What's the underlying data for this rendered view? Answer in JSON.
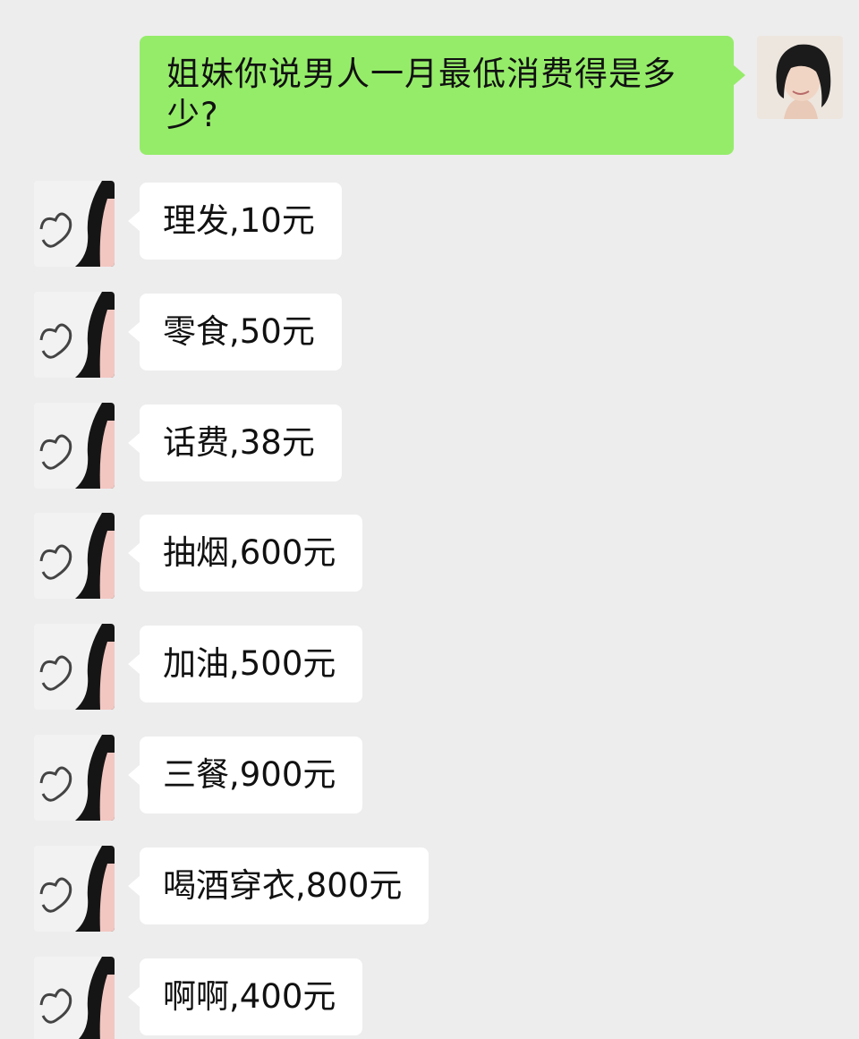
{
  "outgoing": {
    "text": "姐妹你说男人一月最低消费得是多少?"
  },
  "incoming": [
    {
      "text": "理发,10元"
    },
    {
      "text": "零食,50元"
    },
    {
      "text": "话费,38元"
    },
    {
      "text": "抽烟,600元"
    },
    {
      "text": "加油,500元"
    },
    {
      "text": "三餐,900元"
    },
    {
      "text": "喝酒穿衣,800元"
    },
    {
      "text": "啊啊,400元"
    }
  ],
  "colors": {
    "background": "#ededed",
    "outgoing_bubble": "#95ec69",
    "incoming_bubble": "#ffffff"
  }
}
